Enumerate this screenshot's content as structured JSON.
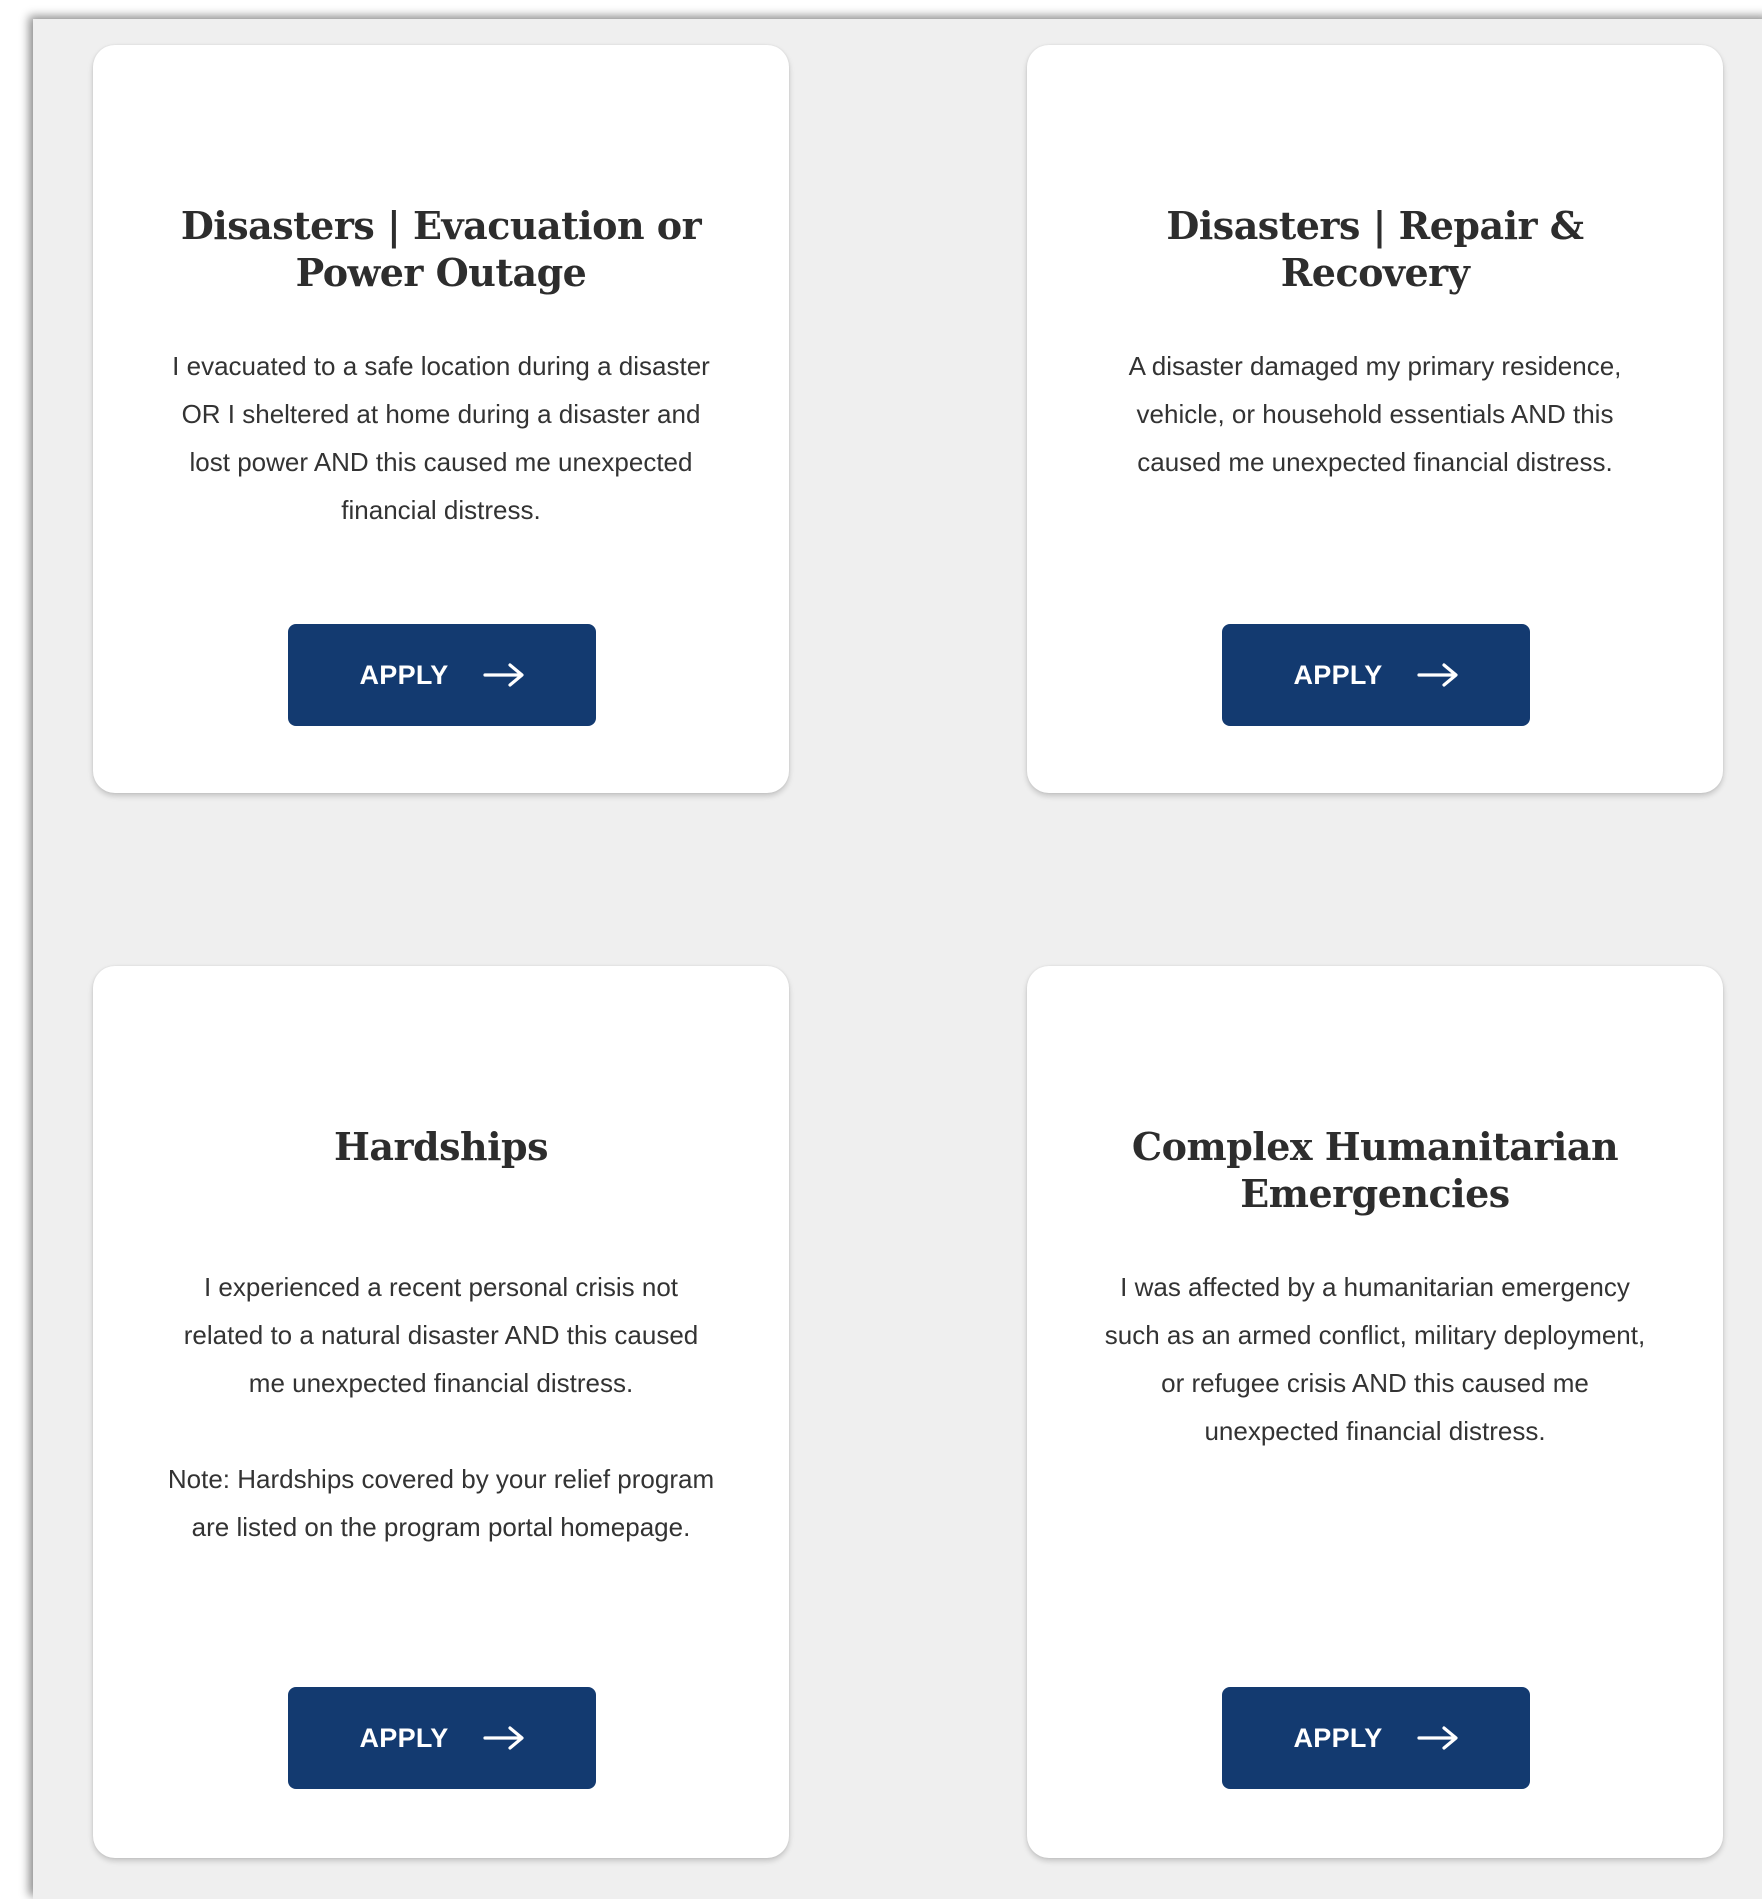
{
  "colors": {
    "background": "#efefef",
    "card": "#ffffff",
    "button": "#133a70",
    "button_text": "#ffffff",
    "title_text": "#2d2d2d",
    "body_text": "#333333"
  },
  "cards": [
    {
      "title": "Disasters | Evacuation or Power Outage",
      "description": "I evacuated to a safe location during a disaster OR I sheltered at home during a disaster and lost power AND this caused me unexpected financial distress.",
      "button_label": "APPLY",
      "button_icon": "arrow-right-icon"
    },
    {
      "title": "Disasters | Repair & Recovery",
      "description": "A disaster damaged my primary residence, vehicle, or household essentials AND this caused me unexpected financial distress.",
      "button_label": "APPLY",
      "button_icon": "arrow-right-icon"
    },
    {
      "title": "Hardships",
      "description": "I experienced a recent personal crisis not related to a natural disaster AND this caused me unexpected financial distress.",
      "note": "Note: Hardships covered by your relief program are listed on the program portal homepage.",
      "button_label": "APPLY",
      "button_icon": "arrow-right-icon"
    },
    {
      "title": "Complex Humanitarian Emergencies",
      "description": "I was affected by a humanitarian emergency such as an armed conflict, military deployment, or refugee crisis AND this caused me unexpected financial distress.",
      "button_label": "APPLY",
      "button_icon": "arrow-right-icon"
    }
  ]
}
